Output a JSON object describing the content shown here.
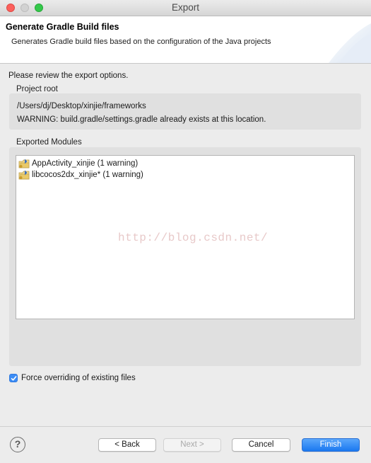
{
  "window": {
    "title": "Export",
    "controls": [
      "close",
      "minimize",
      "maximize"
    ]
  },
  "header": {
    "title": "Generate Gradle Build files",
    "description": "Generates Gradle build files based on the configuration of the Java projects"
  },
  "review_label": "Please review the export options.",
  "project_root": {
    "label": "Project root",
    "path": "/Users/dj/Desktop/xinjie/frameworks",
    "warning": "WARNING: build.gradle/settings.gradle already exists at this location."
  },
  "modules": {
    "label": "Exported Modules",
    "items": [
      {
        "label": "AppActivity_xinjie (1 warning)",
        "icon": "folder-project-icon"
      },
      {
        "label": "libcocos2dx_xinjie* (1 warning)",
        "icon": "folder-project-icon"
      }
    ]
  },
  "watermark": "http://blog.csdn.net/",
  "force_override": {
    "label": "Force overriding of existing files",
    "checked": true
  },
  "buttons": {
    "help": "?",
    "back": "< Back",
    "next": "Next >",
    "cancel": "Cancel",
    "finish": "Finish"
  },
  "colors": {
    "accent": "#1a78f0",
    "close": "#fc605c",
    "maximize": "#34c84a"
  }
}
